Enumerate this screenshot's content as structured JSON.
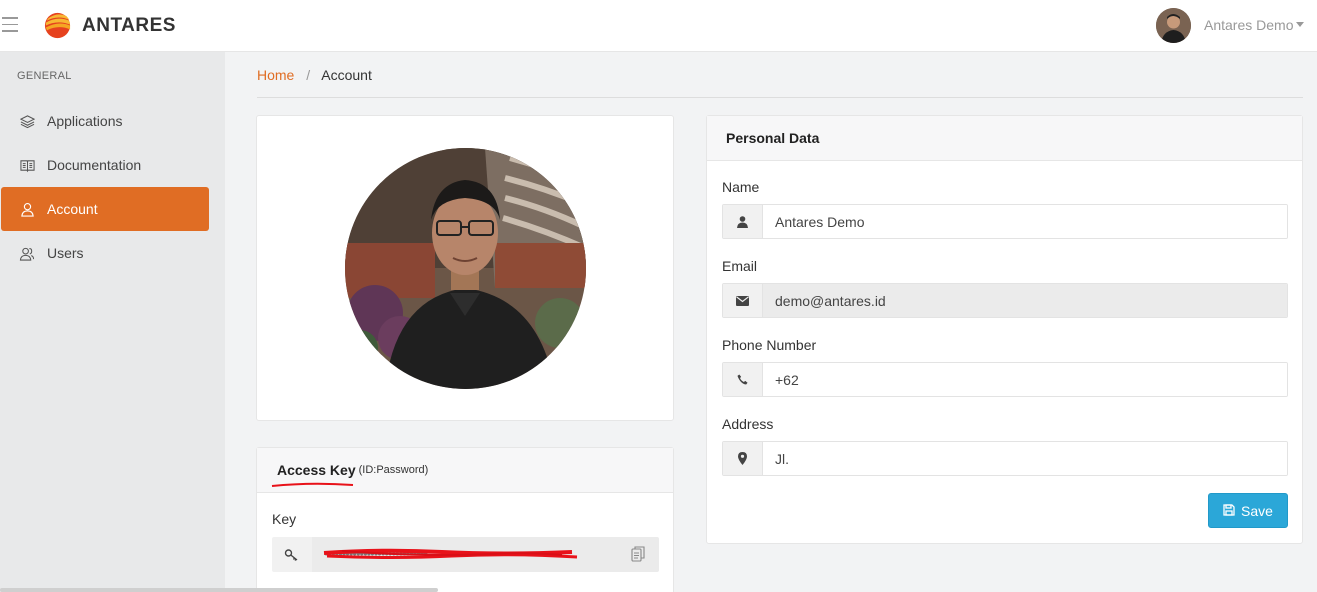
{
  "app": {
    "brand": "ANTARES",
    "user_name": "Antares Demo"
  },
  "sidebar": {
    "section_title": "GENERAL",
    "items": [
      {
        "label": "Applications",
        "icon": "layers-icon",
        "active": false
      },
      {
        "label": "Documentation",
        "icon": "book-icon",
        "active": false
      },
      {
        "label": "Account",
        "icon": "user-icon",
        "active": true
      },
      {
        "label": "Users",
        "icon": "users-icon",
        "active": false
      }
    ]
  },
  "breadcrumb": {
    "home": "Home",
    "separator": "/",
    "current": "Account"
  },
  "access_key": {
    "title": "Access Key",
    "subtitle": "(ID:Password)",
    "key_label": "Key",
    "key_value": "•••••••••••••••••••••••••••••"
  },
  "personal_data": {
    "title": "Personal Data",
    "name_label": "Name",
    "name_value": "Antares Demo",
    "email_label": "Email",
    "email_value": "demo@antares.id",
    "phone_label": "Phone Number",
    "phone_value": "+62",
    "address_label": "Address",
    "address_value": "Jl.",
    "save_label": "Save"
  },
  "colors": {
    "accent": "#e06d24",
    "save_button": "#2ba7d8",
    "sidebar_bg": "#e8e9ea",
    "redaction": "#e8121a"
  }
}
